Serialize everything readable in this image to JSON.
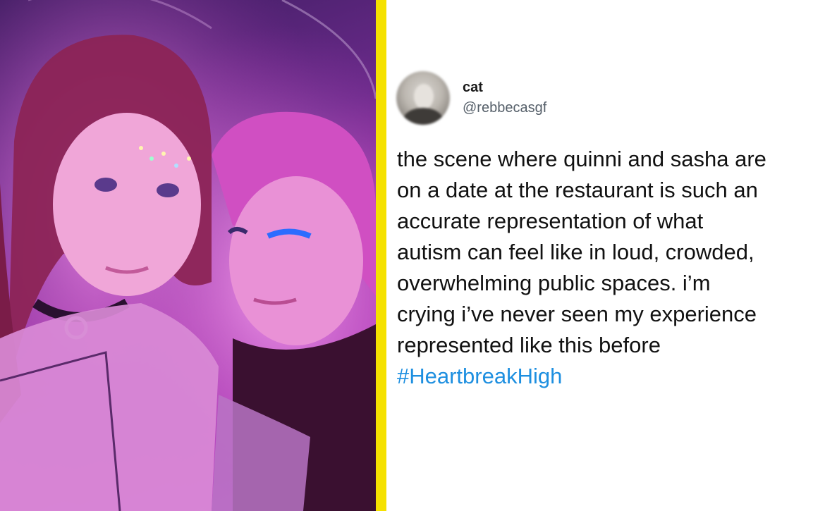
{
  "photo": {
    "alt_icon": "portrait-photo"
  },
  "tweet": {
    "display_name": "cat",
    "handle": "@rebbecasgf",
    "text_lines": [
      "the scene where quinni and sasha are",
      "on a date at the restaurant is such an",
      "accurate representation of what",
      "autism can feel like in loud, crowded,",
      "overwhelming public spaces. i’m",
      "crying i’ve never seen my experience",
      "represented like this before"
    ],
    "hashtag": "#HeartbreakHigh"
  },
  "colors": {
    "divider": "#f5e100",
    "hashtag": "#1d8fe0",
    "handle": "#555f69"
  }
}
